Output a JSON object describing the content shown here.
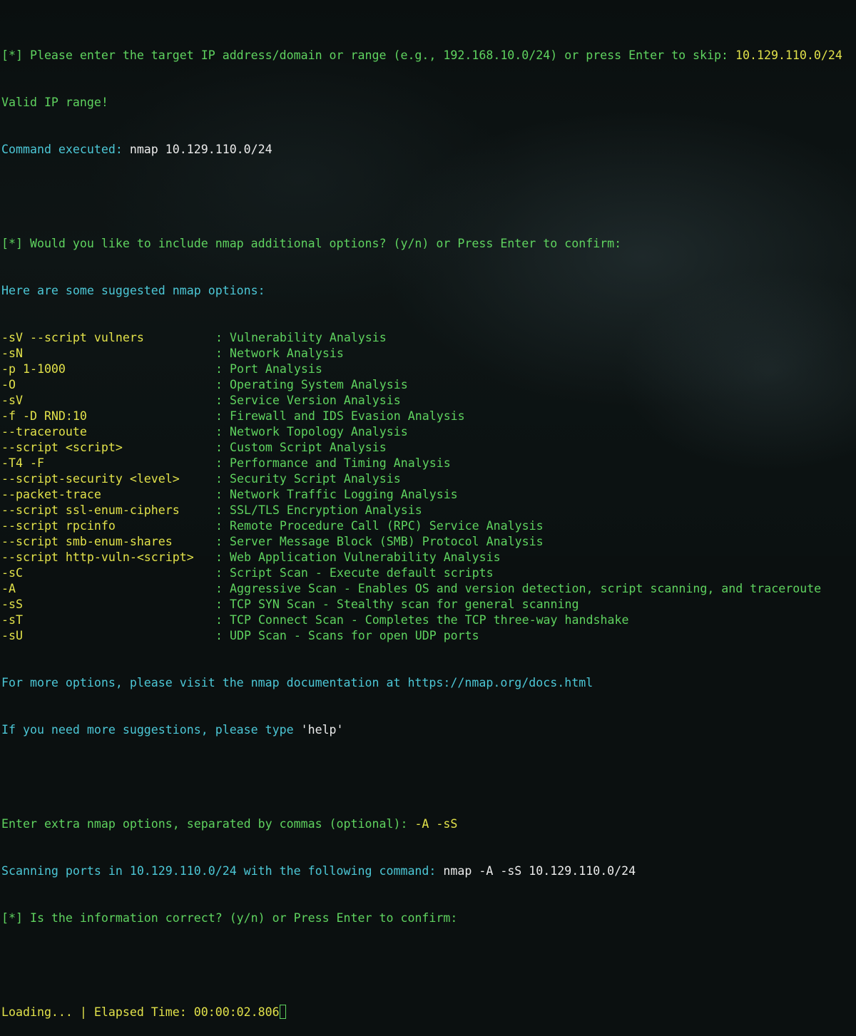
{
  "prompt_target": "[*] Please enter the target IP address/domain or range (e.g., 192.168.10.0/24) or press Enter to skip: ",
  "target_value": "10.129.110.0/24",
  "valid_msg": "Valid IP range!",
  "cmd_exec_label": "Command executed: ",
  "cmd_exec_value": "nmap 10.129.110.0/24",
  "prompt_options": "[*] Would you like to include nmap additional options? (y/n) or Press Enter to confirm:",
  "suggest_header": "Here are some suggested nmap options:",
  "options": [
    {
      "flag": "-sV --script vulners",
      "desc": ": Vulnerability Analysis"
    },
    {
      "flag": "-sN",
      "desc": ": Network Analysis"
    },
    {
      "flag": "-p 1-1000",
      "desc": ": Port Analysis"
    },
    {
      "flag": "-O",
      "desc": ": Operating System Analysis"
    },
    {
      "flag": "-sV",
      "desc": ": Service Version Analysis"
    },
    {
      "flag": "-f -D RND:10",
      "desc": ": Firewall and IDS Evasion Analysis"
    },
    {
      "flag": "--traceroute",
      "desc": ": Network Topology Analysis"
    },
    {
      "flag": "--script <script>",
      "desc": ": Custom Script Analysis"
    },
    {
      "flag": "-T4 -F",
      "desc": ": Performance and Timing Analysis"
    },
    {
      "flag": "--script-security <level>",
      "desc": ": Security Script Analysis"
    },
    {
      "flag": "--packet-trace",
      "desc": ": Network Traffic Logging Analysis"
    },
    {
      "flag": "--script ssl-enum-ciphers",
      "desc": ": SSL/TLS Encryption Analysis"
    },
    {
      "flag": "--script rpcinfo",
      "desc": ": Remote Procedure Call (RPC) Service Analysis"
    },
    {
      "flag": "--script smb-enum-shares",
      "desc": ": Server Message Block (SMB) Protocol Analysis"
    },
    {
      "flag": "--script http-vuln-<script>",
      "desc": ": Web Application Vulnerability Analysis"
    },
    {
      "flag": "-sC",
      "desc": ": Script Scan - Execute default scripts"
    },
    {
      "flag": "-A",
      "desc": ": Aggressive Scan - Enables OS and version detection, script scanning, and traceroute"
    },
    {
      "flag": "-sS",
      "desc": ": TCP SYN Scan - Stealthy scan for general scanning"
    },
    {
      "flag": "-sT",
      "desc": ": TCP Connect Scan - Completes the TCP three-way handshake"
    },
    {
      "flag": "-sU",
      "desc": ": UDP Scan - Scans for open UDP ports"
    }
  ],
  "more_options": "For more options, please visit the nmap documentation at https://nmap.org/docs.html",
  "help_prefix": "If you need more suggestions, please type ",
  "help_word": "'help'",
  "extra_prompt": "Enter extra nmap options, separated by commas (optional): ",
  "extra_value": "-A -sS",
  "scan_label": "Scanning ports in 10.129.110.0/24 with the following command: ",
  "scan_cmd": "nmap -A -sS 10.129.110.0/24",
  "confirm_prompt": "[*] Is the information correct? (y/n) or Press Enter to confirm:",
  "loading": "Loading... | Elapsed Time: 00:00:02.806",
  "colors": {
    "green": "#5fd35f",
    "cyan": "#4cc7d6",
    "yellow": "#e2e24a",
    "white": "#ececec"
  }
}
